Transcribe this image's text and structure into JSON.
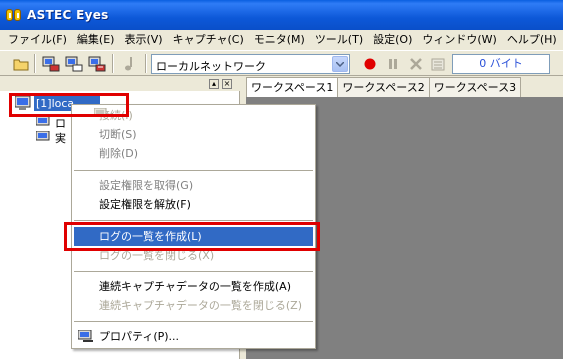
{
  "window": {
    "title": "ASTEC Eyes"
  },
  "menubar": [
    "ファイル(F)",
    "編集(E)",
    "表示(V)",
    "キャプチャ(C)",
    "モニタ(M)",
    "ツール(T)",
    "設定(O)",
    "ウィンドウ(W)",
    "ヘルプ(H)"
  ],
  "toolbar": {
    "adapter_combo_value": "ローカルネットワーク",
    "byte_counter": "0 バイト"
  },
  "tree": {
    "root_label": "[1]loca",
    "child1_label": "ロ",
    "child2_label": "実"
  },
  "tabs": [
    "ワークスペース1",
    "ワークスペース2",
    "ワークスペース3"
  ],
  "context_menu": {
    "connect": "接続(I)",
    "disconnect": "切断(S)",
    "delete": "削除(D)",
    "get_setting_right": "設定権限を取得(G)",
    "release_setting_right": "設定権限を解放(F)",
    "create_log_list": "ログの一覧を作成(L)",
    "close_log_list": "ログの一覧を閉じる(X)",
    "create_capture_list": "連続キャプチャデータの一覧を作成(A)",
    "close_capture_list": "連続キャプチャデータの一覧を閉じる(Z)",
    "properties": "プロパティ(P)..."
  },
  "colors": {
    "title_bar": "#0a5fe0",
    "selection": "#316ac5",
    "annotation": "#e00000",
    "record_button": "#e00000"
  }
}
